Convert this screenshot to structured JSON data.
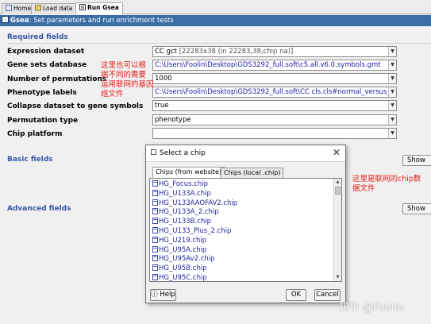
{
  "tabs": [
    {
      "label": "Home"
    },
    {
      "label": "Load data"
    },
    {
      "label": "Run Gsea"
    }
  ],
  "titlebar": {
    "prefix": "Gsea",
    "text": ": Set parameters and run enrichment tests"
  },
  "required_fields": {
    "title": "Required fields",
    "rows": [
      {
        "label": "Expression dataset",
        "value": "CC gct",
        "value_sub": " [22283x38 (in 22283,38,chip na)]"
      },
      {
        "label": "Gene sets database",
        "value": "C:\\Users\\Foolin\\Desktop\\GDS3292_full.soft\\c5.all.v6.0.symbols.gmt"
      },
      {
        "label": "Number of permutations",
        "value": "1000"
      },
      {
        "label": "Phenotype labels",
        "value": "C:\\Users\\Foolin\\Desktop\\GDS3292_full.soft\\CC cls.cls#normal_versus_REST"
      },
      {
        "label": "Collapse dataset to gene symbols",
        "value": "true"
      },
      {
        "label": "Permutation type",
        "value": "phenotype"
      },
      {
        "label": "Chip platform",
        "value": ""
      }
    ]
  },
  "basic_fields": {
    "title": "Basic fields",
    "show_label": "Show"
  },
  "advanced_fields": {
    "title": "Advanced fields",
    "show_label": "Show"
  },
  "annotations": {
    "left": [
      "这里也可以根",
      "据不同的需要",
      "运用联网的基因",
      "组文件"
    ],
    "right": [
      "这里是联网的chip数",
      "据文件"
    ]
  },
  "dialog": {
    "title": "Select a chip",
    "close": "✕",
    "tabs": [
      {
        "label": "Chips (from website)"
      },
      {
        "label": "Chips (local .chip)"
      }
    ],
    "items": [
      "HG_Focus.chip",
      "HG_U133A.chip",
      "HG_U133AAOFAV2.chip",
      "HG_U133A_2.chip",
      "HG_U133B.chip",
      "HG_U133_Plus_2.chip",
      "HG_U219.chip",
      "HG_U95A.chip",
      "HG_U95Av2.chip",
      "HG_U95B.chip",
      "HG_U95C.chip"
    ],
    "help_label": "Help",
    "ok_label": "OK",
    "cancel_label": "Cancel"
  },
  "watermark": "知乎 @Foolin"
}
